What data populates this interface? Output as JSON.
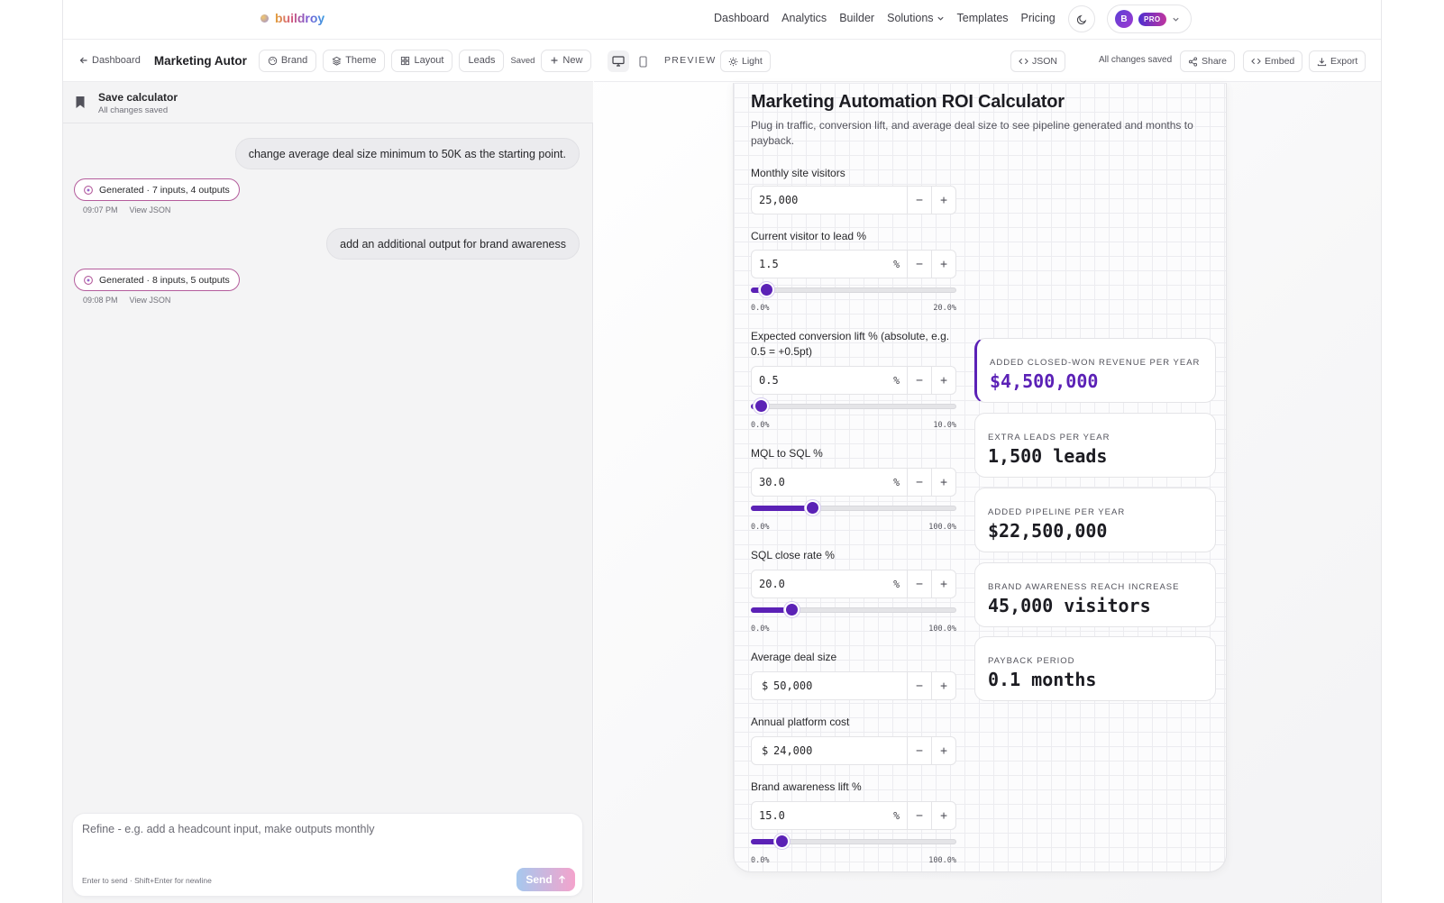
{
  "nav": {
    "logo": "buildroy",
    "links": [
      "Dashboard",
      "Analytics",
      "Builder",
      "Solutions",
      "Templates",
      "Pricing"
    ],
    "avatar_initial": "B",
    "plan_badge": "PRO"
  },
  "left_toolbar": {
    "back_label": "Dashboard",
    "calculator_title": "Marketing Autor",
    "brand_label": "Brand",
    "theme_label": "Theme",
    "layout_label": "Layout",
    "leads_label": "Leads",
    "saved_status": "Saved",
    "new_label": "New"
  },
  "save_bar": {
    "title": "Save calculator",
    "subtitle": "All changes saved"
  },
  "chat": {
    "messages": [
      {
        "user_text": "change average deal size minimum to 50K as the starting point.",
        "generated": "Generated · 7 inputs, 4 outputs",
        "time": "09:07 PM",
        "view_json": "View JSON"
      },
      {
        "user_text": "add an additional output for brand awareness",
        "generated": "Generated · 8 inputs, 5 outputs",
        "time": "09:08 PM",
        "view_json": "View JSON"
      }
    ]
  },
  "composer": {
    "placeholder": "Refine - e.g. add a headcount input, make outputs monthly",
    "hint": "Enter to send · Shift+Enter for newline",
    "send_label": "Send"
  },
  "right_toolbar": {
    "preview_label": "PREVIEW",
    "light_label": "Light",
    "json_label": "JSON",
    "status": "All changes saved",
    "share_label": "Share",
    "embed_label": "Embed",
    "export_label": "Export"
  },
  "calculator": {
    "title": "Marketing Automation ROI Calculator",
    "description": "Plug in traffic, conversion lift, and average deal size to see pipeline generated and months to payback.",
    "inputs": [
      {
        "label": "Monthly site visitors",
        "value": "25,000"
      },
      {
        "label": "Current visitor to lead %",
        "value": "1.5",
        "unit": "%",
        "min": "0.0%",
        "max": "20.0%",
        "fraction": 0.075
      },
      {
        "label": "Expected conversion lift % (absolute, e.g. 0.5 = +0.5pt)",
        "value": "0.5",
        "unit": "%",
        "min": "0.0%",
        "max": "10.0%",
        "fraction": 0.05
      },
      {
        "label": "MQL to SQL %",
        "value": "30.0",
        "unit": "%",
        "min": "0.0%",
        "max": "100.0%",
        "fraction": 0.3
      },
      {
        "label": "SQL close rate %",
        "value": "20.0",
        "unit": "%",
        "min": "0.0%",
        "max": "100.0%",
        "fraction": 0.2
      },
      {
        "label": "Average deal size",
        "currency": "$",
        "value": "50,000"
      },
      {
        "label": "Annual platform cost",
        "currency": "$",
        "value": "24,000"
      },
      {
        "label": "Brand awareness lift %",
        "value": "15.0",
        "unit": "%",
        "min": "0.0%",
        "max": "100.0%",
        "fraction": 0.15
      }
    ],
    "outputs": [
      {
        "label": "ADDED CLOSED-WON REVENUE PER YEAR",
        "value": "$4,500,000"
      },
      {
        "label": "EXTRA LEADS PER YEAR",
        "value": "1,500 leads"
      },
      {
        "label": "ADDED PIPELINE PER YEAR",
        "value": "$22,500,000"
      },
      {
        "label": "BRAND AWARENESS REACH INCREASE",
        "value": "45,000 visitors"
      },
      {
        "label": "PAYBACK PERIOD",
        "value": "0.1 months"
      }
    ]
  },
  "colors": {
    "accent": "#5b21b6",
    "chip_border": "#b45c9c"
  }
}
